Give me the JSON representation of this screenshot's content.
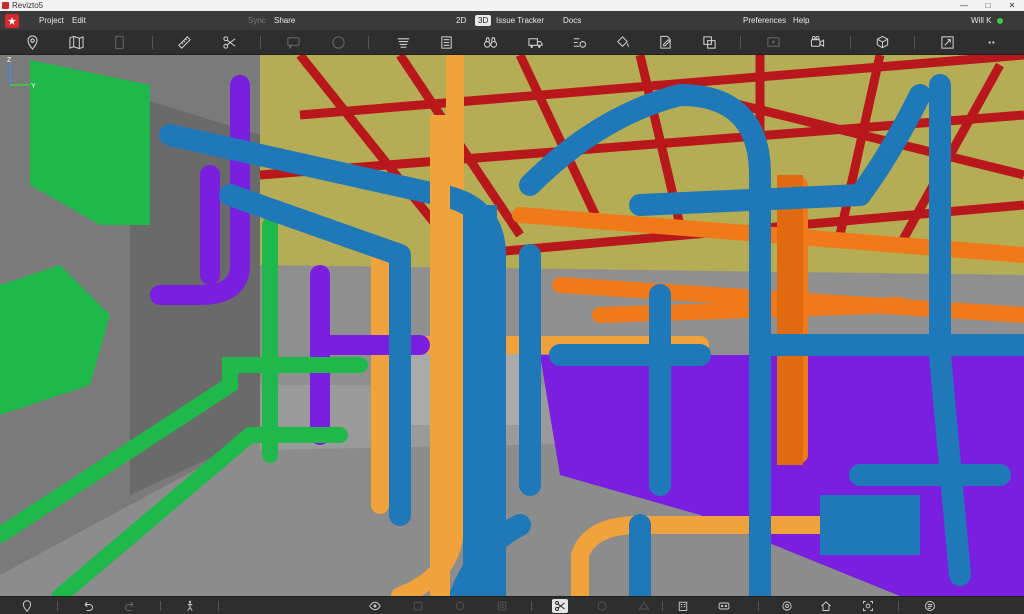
{
  "window": {
    "title": "Revizto5",
    "minimize": "—",
    "maximize": "□",
    "close": "✕"
  },
  "menu": {
    "project": "Project",
    "edit": "Edit",
    "sync": "Sync",
    "share": "Share",
    "view_2d": "2D",
    "view_3d": "3D",
    "issue_tracker": "Issue Tracker",
    "docs": "Docs",
    "preferences": "Preferences",
    "help": "Help",
    "user": "Will K"
  },
  "toolbar": {
    "icons": [
      "location-pin-icon",
      "map-icon",
      "sheet-icon",
      "ruler-icon",
      "scissors-icon",
      "comment-icon",
      "stamp-icon",
      "layers-icon",
      "list-icon",
      "binoculars-icon",
      "truck-icon",
      "flow-icon",
      "paint-bucket-icon",
      "edit-doc-icon",
      "clash-icon",
      "video-icon",
      "camera-icon",
      "box-add-icon",
      "resize-icon",
      "more-icon"
    ]
  },
  "colors": {
    "pipe_blue": "#1f78b8",
    "pipe_purple": "#7a1fe0",
    "pipe_orange": "#f07a1a",
    "pipe_tan": "#f0a23c",
    "pipe_green": "#1fb84a",
    "beam_red": "#b8181c",
    "ceiling": "#b5ad55"
  },
  "axis": {
    "z": "Z",
    "y": "Y"
  }
}
